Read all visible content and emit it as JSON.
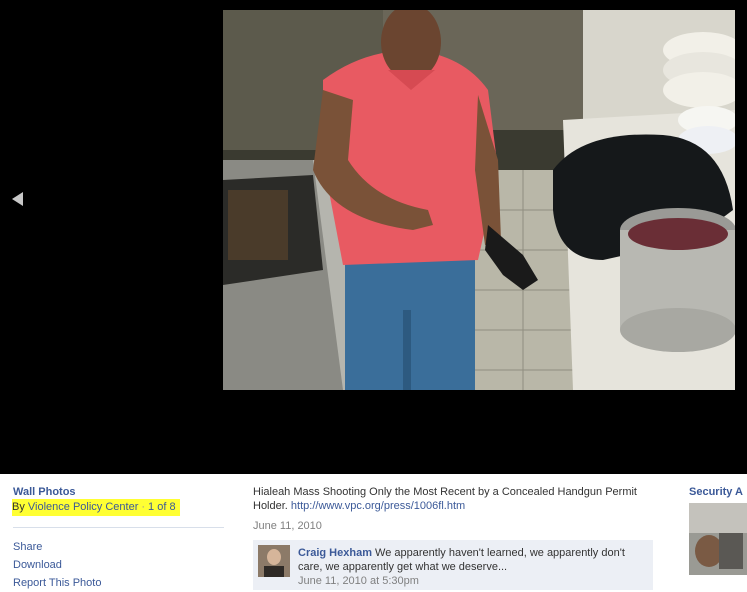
{
  "viewer": {
    "prev_icon": "left-triangle-icon",
    "photo_alt": "Surveillance camera still: man in a pink polo shirt holding a handgun in a restaurant kitchen"
  },
  "album": {
    "title": "Wall Photos",
    "by_prefix": "By",
    "owner": "Violence Policy Center",
    "separator": "·",
    "position": "1 of 8"
  },
  "actions": [
    "Share",
    "Download",
    "Report This Photo"
  ],
  "caption": {
    "text": "Hialeah Mass Shooting Only the Most Recent by a Concealed Handgun Permit Holder.",
    "link": "http://www.vpc.org/press/1006fl.htm",
    "date": "June 11, 2010"
  },
  "comment": {
    "author": "Craig Hexham",
    "text": "We apparently haven't learned, we apparently don't care, we apparently get what we deserve...",
    "time": "June 11, 2010 at 5:30pm"
  },
  "sponsor": {
    "title": "Security A"
  },
  "colors": {
    "link": "#3b5998",
    "highlight": "#ffff33",
    "stage": "#000000",
    "comment_bg": "#eceff5"
  }
}
